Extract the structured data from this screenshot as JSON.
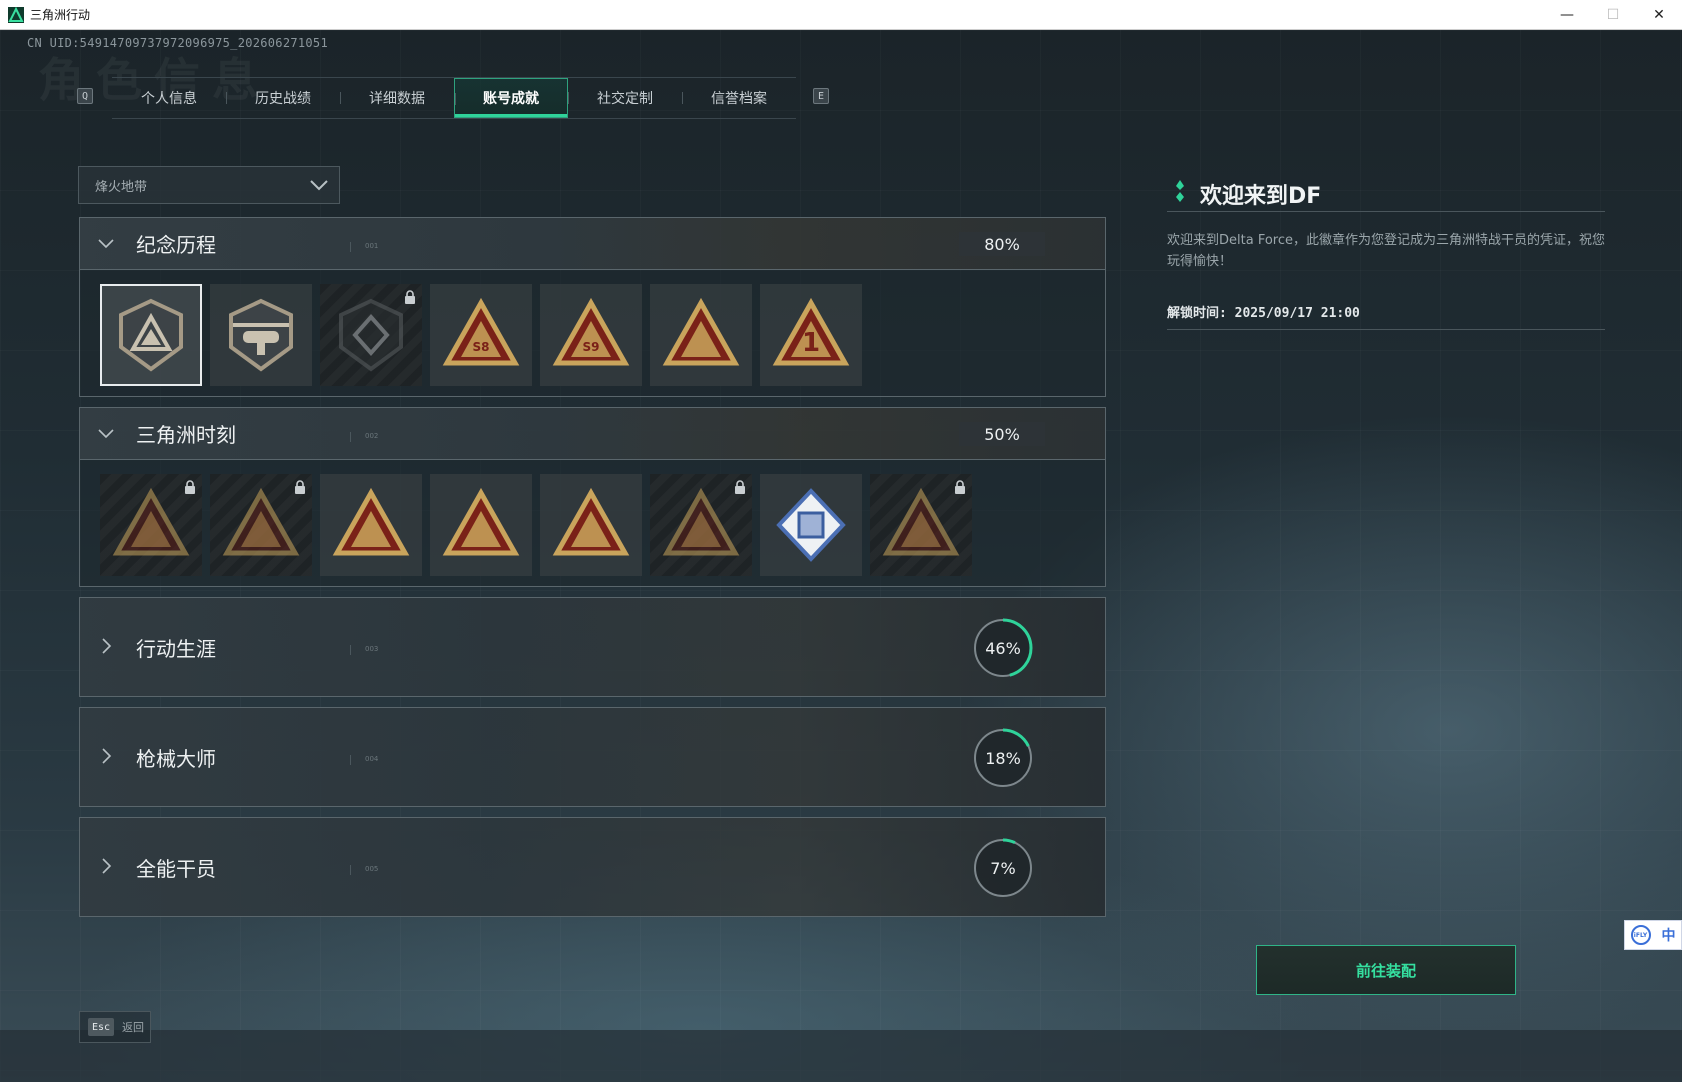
{
  "window": {
    "title": "三角洲行动",
    "minimize": "—",
    "maximize": "☐",
    "close": "✕"
  },
  "uid": "CN UID:5491470973797209697­5_202606271051",
  "bg_title": "角色信息",
  "tabs": {
    "left_key": "Q",
    "right_key": "E",
    "items": [
      {
        "label": "个人信息"
      },
      {
        "label": "历史战绩"
      },
      {
        "label": "详细数据"
      },
      {
        "label": "账号成就",
        "active": true
      },
      {
        "label": "社交定制"
      },
      {
        "label": "信誉档案"
      }
    ]
  },
  "mode_select": {
    "value": "烽火地带"
  },
  "categories": [
    {
      "title": "纪念历程",
      "index": "001",
      "progress_text": "80%",
      "progress": 0.8,
      "expanded": true,
      "badges": [
        {
          "icon": "delta-shield-badge-icon",
          "locked": false,
          "selected": true
        },
        {
          "icon": "helicopter-badge-icon",
          "locked": false
        },
        {
          "icon": "dark-emblem-badge-icon",
          "locked": true
        },
        {
          "icon": "s8-season-badge-icon",
          "locked": false,
          "text": "S8"
        },
        {
          "icon": "s9-season-badge-icon",
          "locked": false,
          "text": "S9"
        },
        {
          "icon": "fortune-badge-icon",
          "locked": false
        },
        {
          "icon": "first-place-badge-icon",
          "locked": false,
          "text": "1"
        }
      ]
    },
    {
      "title": "三角洲时刻",
      "index": "002",
      "progress_text": "50%",
      "progress": 0.5,
      "expanded": true,
      "badges": [
        {
          "icon": "robot-badge-icon",
          "locked": true
        },
        {
          "icon": "climber-badge-icon",
          "locked": true
        },
        {
          "icon": "dice-badge-icon",
          "locked": false
        },
        {
          "icon": "squad-badge-icon",
          "locked": false
        },
        {
          "icon": "dragon-badge-icon",
          "locked": false
        },
        {
          "icon": "fish-badge-icon",
          "locked": true
        },
        {
          "icon": "cube-badge-icon",
          "locked": false
        },
        {
          "icon": "emblem-badge-icon",
          "locked": true
        }
      ]
    },
    {
      "title": "行动生涯",
      "index": "003",
      "progress_text": "46%",
      "progress": 0.46,
      "expanded": false
    },
    {
      "title": "枪械大师",
      "index": "004",
      "progress_text": "18%",
      "progress": 0.18,
      "expanded": false
    },
    {
      "title": "全能干员",
      "index": "005",
      "progress_text": "7%",
      "progress": 0.07,
      "expanded": false
    }
  ],
  "detail": {
    "title": "欢迎来到DF",
    "description": "欢迎来到Delta Force，此徽章作为您登记成为三角洲特战干员的凭证，祝您玩得愉快！",
    "unlock_time": "解锁时间: 2025/09/17 21:00"
  },
  "equip_button": "前往装配",
  "esc": {
    "key": "Esc",
    "label": "返回"
  },
  "ime": {
    "logo": "iFLY",
    "lang": "中"
  },
  "colors": {
    "accent": "#2fd39a",
    "gold": "#c9a45c",
    "badge_red": "#7a2118"
  }
}
